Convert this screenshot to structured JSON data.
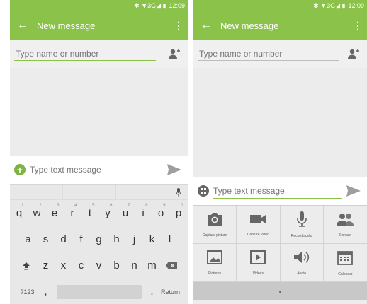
{
  "colors": {
    "accent": "#8bc34a",
    "accent_dark": "#7cb342",
    "icon_gray": "#666666",
    "send_gray": "#9e9e9e"
  },
  "left": {
    "status": {
      "icons": "✱ ▼3G◢ ▮",
      "time": "12:09"
    },
    "toolbar": {
      "back_icon": "arrow-left-icon",
      "title": "New message",
      "overflow_icon": "more-vert-icon"
    },
    "recipient": {
      "placeholder": "Type name or number",
      "add_icon": "person-add-icon"
    },
    "compose": {
      "placeholder": "Type text message",
      "attach_icon": "plus-circle-icon",
      "send_icon": "send-icon"
    },
    "keyboard": {
      "row1": [
        {
          "k": "q",
          "n": "1"
        },
        {
          "k": "w",
          "n": "2"
        },
        {
          "k": "e",
          "n": "3"
        },
        {
          "k": "r",
          "n": "4"
        },
        {
          "k": "t",
          "n": "5"
        },
        {
          "k": "y",
          "n": "6"
        },
        {
          "k": "u",
          "n": "7"
        },
        {
          "k": "i",
          "n": "8"
        },
        {
          "k": "o",
          "n": "9"
        },
        {
          "k": "p",
          "n": "0"
        }
      ],
      "row2": [
        "a",
        "s",
        "d",
        "f",
        "g",
        "h",
        "j",
        "k",
        "l"
      ],
      "row3": [
        "z",
        "x",
        "c",
        "v",
        "b",
        "n",
        "m"
      ],
      "symbols_label": "?123",
      "comma": ",",
      "period": ".",
      "return_label": "Return",
      "mic_icon": "mic-icon",
      "shift_icon": "shift-icon",
      "backspace_icon": "backspace-icon"
    }
  },
  "right": {
    "status": {
      "icons": "✱ ▼3G◢ ▮",
      "time": "12:09"
    },
    "toolbar": {
      "back_icon": "arrow-left-icon",
      "title": "New message",
      "overflow_icon": "more-vert-icon"
    },
    "recipient": {
      "placeholder": "Type name or number",
      "add_icon": "person-add-icon"
    },
    "compose": {
      "placeholder": "Type text message",
      "attach_icon": "grid-circle-icon",
      "send_icon": "send-icon"
    },
    "attachments": [
      {
        "label": "Capture picture",
        "icon": "camera-icon"
      },
      {
        "label": "Capture video",
        "icon": "videocam-icon"
      },
      {
        "label": "Record audio",
        "icon": "mic-icon"
      },
      {
        "label": "Contact",
        "icon": "contacts-icon"
      },
      {
        "label": "Pictures",
        "icon": "image-icon"
      },
      {
        "label": "Videos",
        "icon": "play-box-icon"
      },
      {
        "label": "Audio",
        "icon": "speaker-icon"
      },
      {
        "label": "Calendar",
        "icon": "calendar-icon"
      }
    ]
  }
}
